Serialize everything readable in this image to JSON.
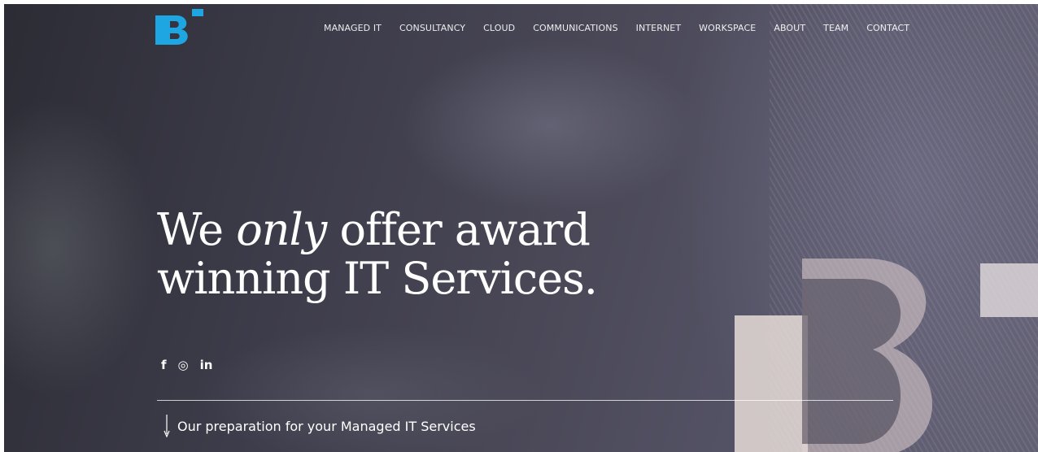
{
  "brand": {
    "logo_name": "B-logo",
    "accent": "#1ea6e3"
  },
  "nav": {
    "items": [
      "MANAGED IT",
      "CONSULTANCY",
      "CLOUD",
      "COMMUNICATIONS",
      "INTERNET",
      "WORKSPACE",
      "ABOUT",
      "TEAM",
      "CONTACT"
    ]
  },
  "hero": {
    "headline_part1": "We ",
    "headline_emph": "only",
    "headline_part2": " offer award",
    "headline_line2": "winning IT Services."
  },
  "social": {
    "icons": [
      {
        "name": "facebook-icon",
        "glyph": "f"
      },
      {
        "name": "instagram-icon",
        "glyph": "◎"
      },
      {
        "name": "linkedin-icon",
        "glyph": "in"
      }
    ]
  },
  "scroll_cue": {
    "text": "Our preparation for your Managed IT Services"
  }
}
